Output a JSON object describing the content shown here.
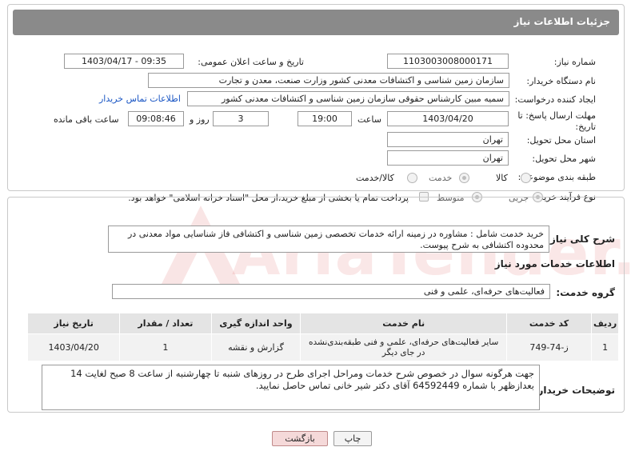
{
  "header": {
    "title": "جزئیات اطلاعات نیاز"
  },
  "form": {
    "need_number_label": "شماره نیاز:",
    "need_number_value": "1103003008000171",
    "announce_datetime_label": "تاریخ و ساعت اعلان عمومی:",
    "announce_datetime_value": "1403/04/17 - 09:35",
    "buyer_org_label": "نام دستگاه خریدار:",
    "buyer_org_value": "سازمان زمین شناسی و اکتشافات معدنی کشور وزارت صنعت، معدن و تجارت",
    "requester_label": "ایجاد کننده درخواست:",
    "requester_value": "سمیه مبین کارشناس حقوقی سازمان زمین شناسی و اکتشافات معدنی کشور",
    "buyer_contact_link": "اطلاعات تماس خریدار",
    "deadline_label": "مهلت ارسال پاسخ: تا تاریخ:",
    "deadline_date": "1403/04/20",
    "time_label": "ساعت",
    "deadline_time": "19:00",
    "days_value": "3",
    "days_label": "روز و",
    "remaining_time": "09:08:46",
    "remaining_label": "ساعت باقی مانده",
    "province_label": "استان محل تحویل:",
    "province_value": "تهران",
    "city_label": "شهر محل تحویل:",
    "city_value": "تهران",
    "category_label": "طبقه بندی موضوعی:",
    "category_options": [
      "کالا",
      "خدمت",
      "کالا/خدمت"
    ],
    "category_selected": "خدمت",
    "process_label": "نوع فرآیند خرید :",
    "process_options": [
      "جزیی",
      "متوسط"
    ],
    "process_selected": "جزیی",
    "payment_note": "پرداخت تمام یا بخشی از مبلغ خرید،از محل \"اسناد خزانه اسلامی\" خواهد بود."
  },
  "details": {
    "description_label": "شرح کلی نیاز:",
    "description_value": "خرید خدمت شامل : مشاوره در زمینه  ارائه خدمات تخصصی زمین شناسی و اکتشافی فاز شناسایی مواد معدنی در محدوده اکتشافی  به شرح پیوست.",
    "services_heading": "اطلاعات خدمات مورد نیاز",
    "service_group_label": "گروه خدمت:",
    "service_group_value": "فعالیت‌های حرفه‌ای، علمی و فنی",
    "table": {
      "headers": [
        "ردیف",
        "کد خدمت",
        "نام خدمت",
        "واحد اندازه گیری",
        "تعداد / مقدار",
        "تاریخ نیاز"
      ],
      "rows": [
        [
          "1",
          "ز-74-749",
          "سایر فعالیت‌های حرفه‌ای، علمی و فنی طبقه‌بندی‌نشده در جای دیگر",
          "گزارش و نقشه",
          "1",
          "1403/04/20"
        ]
      ]
    },
    "buyer_notes_label": "توضیحات خریدار:",
    "buyer_notes_value": "جهت هرگونه سوال در خصوص شرح خدمات ومراحل اجرای طرح در روزهای شنبه تا چهارشنبه از ساعت 8 صبح لغایت 14 بعدازظهر با شماره 64592449 آقای دکتر شیر خانی  تماس حاصل نمایید."
  },
  "buttons": {
    "print": "چاپ",
    "back": "بازگشت"
  },
  "watermark": {
    "text": "AriaTender.net"
  },
  "colors": {
    "header_bg": "#8a8a8a",
    "link": "#1a56c4",
    "back_button": "#f5d9d9"
  }
}
